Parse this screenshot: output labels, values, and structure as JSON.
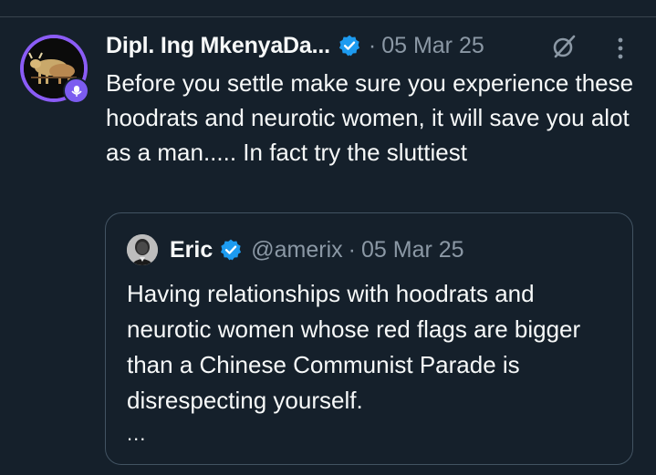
{
  "post": {
    "author_name": "Dipl. Ing MkenyaDa...",
    "separator": "·",
    "date": "05 Mar 25",
    "text": "Before you settle make sure you experience these hoodrats and neurotic women, it will save you alot as a man..... In fact try the sluttiest",
    "icons": {
      "verified": "verified-badge-icon",
      "grok": "grok-icon",
      "more": "more-options-icon",
      "avatar_badge": "space-host-icon"
    }
  },
  "quoted": {
    "author_name": "Eric",
    "handle": "@amerix",
    "separator": "·",
    "date": "05 Mar 25",
    "text": "Having relationships with hoodrats and neurotic women whose red flags are bigger than a Chinese Communist Parade is disrespecting yourself.",
    "truncation": "..."
  },
  "colors": {
    "background": "#15202b",
    "text_primary": "#f7f9f9",
    "text_secondary": "#8b98a5",
    "verified_blue": "#1d9bf0",
    "avatar_ring": "#8b5cf6",
    "border": "#425362"
  }
}
